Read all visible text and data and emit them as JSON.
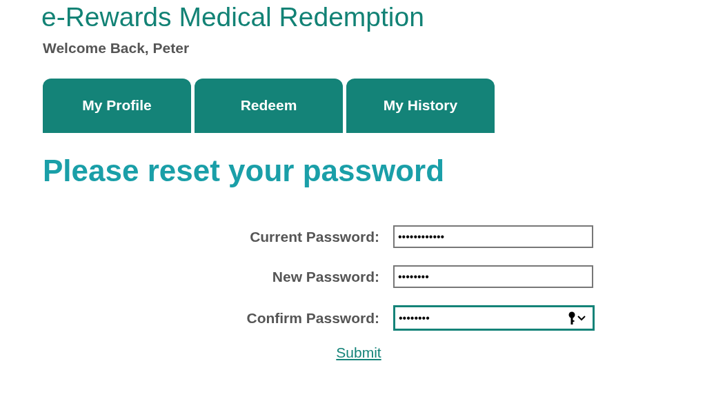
{
  "header": {
    "title": "e-Rewards Medical Redemption",
    "welcome": "Welcome Back, Peter"
  },
  "tabs": [
    {
      "label": "My Profile",
      "selected": false
    },
    {
      "label": "Redeem",
      "selected": false
    },
    {
      "label": "My History",
      "selected": false
    }
  ],
  "heading": "Please reset your password",
  "fields": [
    {
      "label": "Current Password:",
      "value": "••••••••••••",
      "focused": false
    },
    {
      "label": "New Password:",
      "value": "••••••••",
      "focused": false
    },
    {
      "label": "Confirm Password:",
      "value": "••••••••",
      "focused": true
    }
  ],
  "submit": "Submit"
}
